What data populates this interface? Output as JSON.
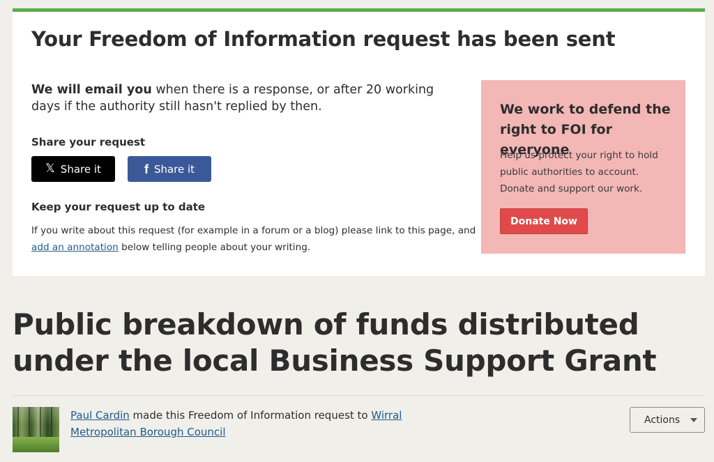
{
  "notice": {
    "title": "Your Freedom of Information request has been sent",
    "lead_bold": "We will email you",
    "lead_rest": " when there is a response, or after 20 working days if the authority still hasn't replied by then.",
    "share_heading": "Share your request",
    "share_x_label": "Share it",
    "share_fb_label": "Share it",
    "keep_heading": "Keep your request up to date",
    "keep_text_before": "If you write about this request (for example in a forum or a blog) please link to this page, and ",
    "keep_link": "add an annotation",
    "keep_text_after": " below telling people about your writing."
  },
  "promo": {
    "title": "We work to defend the right to FOI for everyone",
    "text": "Help us protect your right to hold public authorities to account. Donate and support our work.",
    "donate_label": "Donate Now"
  },
  "request": {
    "title": "Public breakdown of funds distributed under the local Business Support Grant",
    "requester": "Paul Cardin",
    "byline_middle": " made this Freedom of Information request to ",
    "authority": "Wirral Metropolitan Borough Council",
    "actions_label": "Actions"
  },
  "colors": {
    "accent_green": "#5cab51",
    "promo_bg": "#f3b7b6",
    "donate_red": "#e14a4a",
    "facebook_blue": "#3b5998",
    "link_blue": "#1f5a8e"
  },
  "icons": {
    "x": "x-logo-icon",
    "facebook": "facebook-icon",
    "caret": "chevron-down-icon"
  }
}
